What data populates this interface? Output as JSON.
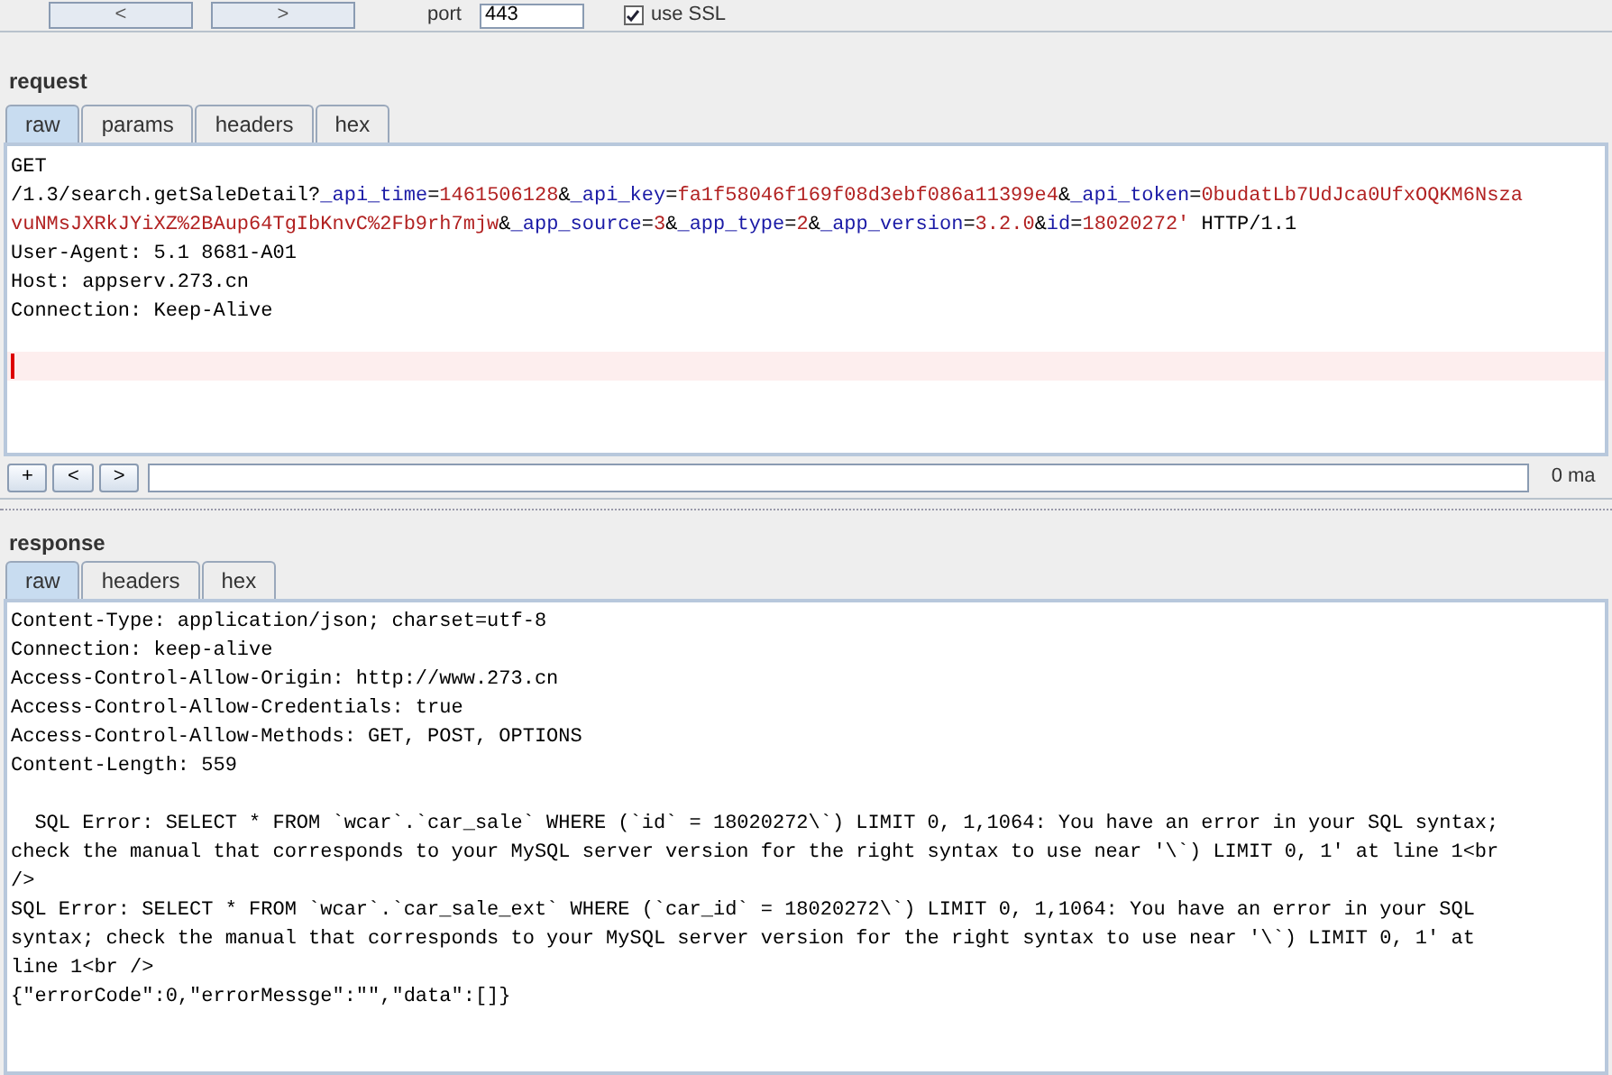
{
  "toolbar": {
    "buttons": [
      "<",
      ">"
    ],
    "port_label": "port",
    "port_value": "443",
    "ssl": {
      "label": "use SSL",
      "checked": true
    }
  },
  "request": {
    "title": "request",
    "tabs": [
      {
        "label": "raw",
        "selected": true
      },
      {
        "label": "params",
        "selected": false
      },
      {
        "label": "headers",
        "selected": false
      },
      {
        "label": "hex",
        "selected": false
      }
    ],
    "lines": [
      [
        {
          "kind": "plain",
          "text": "GET"
        }
      ],
      [
        {
          "kind": "plain",
          "text": "/1.3/search.getSaleDetail?"
        },
        {
          "kind": "name",
          "text": "_api_time"
        },
        {
          "kind": "plain",
          "text": "="
        },
        {
          "kind": "value",
          "text": "1461506128"
        },
        {
          "kind": "plain",
          "text": "&"
        },
        {
          "kind": "name",
          "text": "_api_key"
        },
        {
          "kind": "plain",
          "text": "="
        },
        {
          "kind": "value",
          "text": "fa1f58046f169f08d3ebf086a11399e4"
        },
        {
          "kind": "plain",
          "text": "&"
        },
        {
          "kind": "name",
          "text": "_api_token"
        },
        {
          "kind": "plain",
          "text": "="
        },
        {
          "kind": "value",
          "text": "0budatLb7UdJca0UfxOQKM6Nsza"
        }
      ],
      [
        {
          "kind": "value",
          "text": "vuNMsJXRkJYiXZ%2BAup64TgIbKnvC%2Fb9rh7mjw"
        },
        {
          "kind": "plain",
          "text": "&"
        },
        {
          "kind": "name",
          "text": "_app_source"
        },
        {
          "kind": "plain",
          "text": "="
        },
        {
          "kind": "value",
          "text": "3"
        },
        {
          "kind": "plain",
          "text": "&"
        },
        {
          "kind": "name",
          "text": "_app_type"
        },
        {
          "kind": "plain",
          "text": "="
        },
        {
          "kind": "value",
          "text": "2"
        },
        {
          "kind": "plain",
          "text": "&"
        },
        {
          "kind": "name",
          "text": "_app_version"
        },
        {
          "kind": "plain",
          "text": "="
        },
        {
          "kind": "value",
          "text": "3.2.0"
        },
        {
          "kind": "plain",
          "text": "&"
        },
        {
          "kind": "name",
          "text": "id"
        },
        {
          "kind": "plain",
          "text": "="
        },
        {
          "kind": "value",
          "text": "18020272'"
        },
        {
          "kind": "plain",
          "text": " HTTP/1.1"
        }
      ],
      [
        {
          "kind": "plain",
          "text": "User-Agent: 5.1 8681-A01"
        }
      ],
      [
        {
          "kind": "plain",
          "text": "Host: appserv.273.cn"
        }
      ],
      [
        {
          "kind": "plain",
          "text": "Connection: Keep-Alive"
        }
      ]
    ],
    "search": {
      "buttons": [
        "+",
        "<",
        ">"
      ],
      "matches": "0 ma"
    }
  },
  "response": {
    "title": "response",
    "tabs": [
      {
        "label": "raw",
        "selected": true
      },
      {
        "label": "headers",
        "selected": false
      },
      {
        "label": "hex",
        "selected": false
      }
    ],
    "header_lines": [
      "Content-Type: application/json; charset=utf-8",
      "Connection: keep-alive",
      "Access-Control-Allow-Origin: http://www.273.cn",
      "Access-Control-Allow-Credentials: true",
      "Access-Control-Allow-Methods: GET, POST, OPTIONS",
      "Content-Length: 559"
    ],
    "body_lines": [
      "  SQL Error: SELECT * FROM `wcar`.`car_sale` WHERE (`id` = 18020272\\`) LIMIT 0, 1,1064: You have an error in your SQL syntax;",
      "check the manual that corresponds to your MySQL server version for the right syntax to use near '\\`) LIMIT 0, 1' at line 1<br",
      "/>",
      "SQL Error: SELECT * FROM `wcar`.`car_sale_ext` WHERE (`car_id` = 18020272\\`) LIMIT 0, 1,1064: You have an error in your SQL",
      "syntax; check the manual that corresponds to your MySQL server version for the right syntax to use near '\\`) LIMIT 0, 1' at",
      "line 1<br />",
      "{\"errorCode\":0,\"errorMessge\":\"\",\"data\":[]}"
    ]
  }
}
